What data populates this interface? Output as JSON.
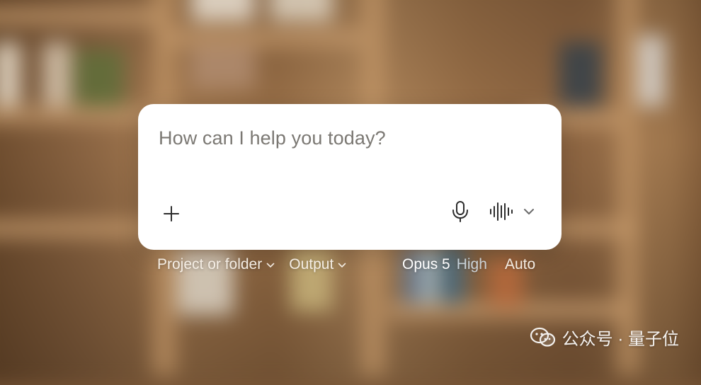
{
  "composer": {
    "placeholder": "How can I help you today?",
    "add_icon": "plus-icon",
    "mic_icon": "microphone-icon",
    "voice_icon": "voice-waveform-icon",
    "voice_menu_icon": "chevron-down-icon"
  },
  "options": {
    "project": "Project or folder",
    "output": "Output",
    "model": "Opus 5",
    "effort": "High",
    "mode": "Auto"
  },
  "watermark": {
    "text": "公众号 · 量子位",
    "icon": "wechat-icon"
  },
  "colors": {
    "card": "#ffffff",
    "placeholder_text": "#7b7873",
    "overlay_text": "#f4ede4",
    "effort_text": "#d9e6f0",
    "backdrop": "#9a7048"
  }
}
